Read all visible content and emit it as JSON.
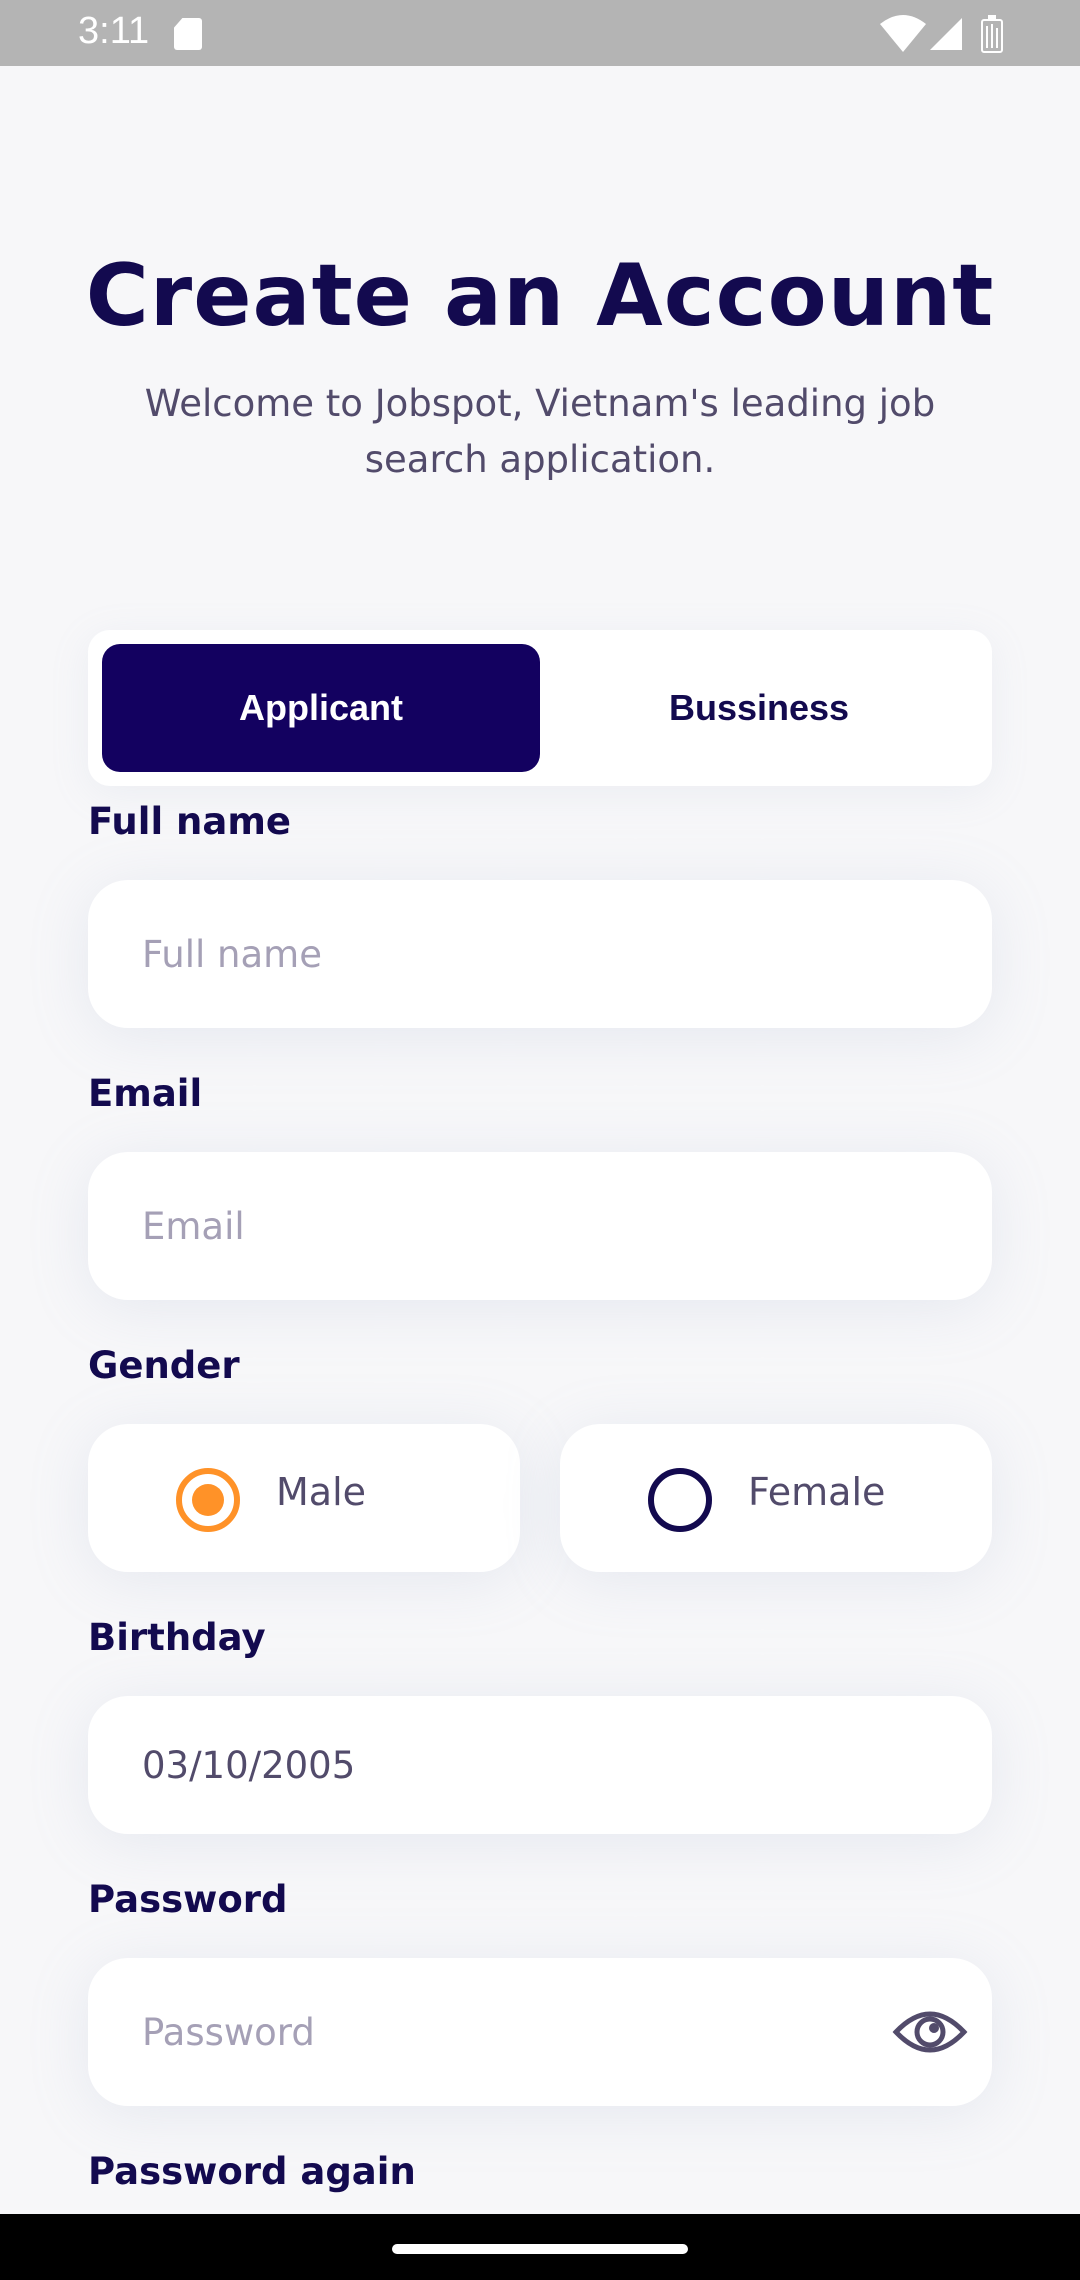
{
  "status_bar": {
    "time": "3:11"
  },
  "header": {
    "title": "Create an Account",
    "subtitle": "Welcome to Jobspot, Vietnam's leading job search application."
  },
  "account_type": {
    "options": [
      "Applicant",
      "Bussiness"
    ],
    "selected": "Applicant"
  },
  "form": {
    "full_name": {
      "label": "Full name",
      "placeholder": "Full name",
      "value": ""
    },
    "email": {
      "label": "Email",
      "placeholder": "Email",
      "value": ""
    },
    "gender": {
      "label": "Gender",
      "options": [
        "Male",
        "Female"
      ],
      "selected": "Male"
    },
    "birthday": {
      "label": "Birthday",
      "value": "03/10/2005"
    },
    "password": {
      "label": "Password",
      "placeholder": "Password",
      "value": ""
    },
    "password_again": {
      "label": "Password again"
    }
  },
  "colors": {
    "primary": "#130160",
    "text": "#130a4f",
    "accent": "#ff9228",
    "muted": "#524b6b",
    "placeholder": "#a5a0b6"
  },
  "icons": {
    "password_toggle": "eye-icon",
    "sd_card": "sd-card-icon",
    "wifi": "wifi-icon",
    "signal": "signal-icon",
    "battery": "battery-icon"
  }
}
